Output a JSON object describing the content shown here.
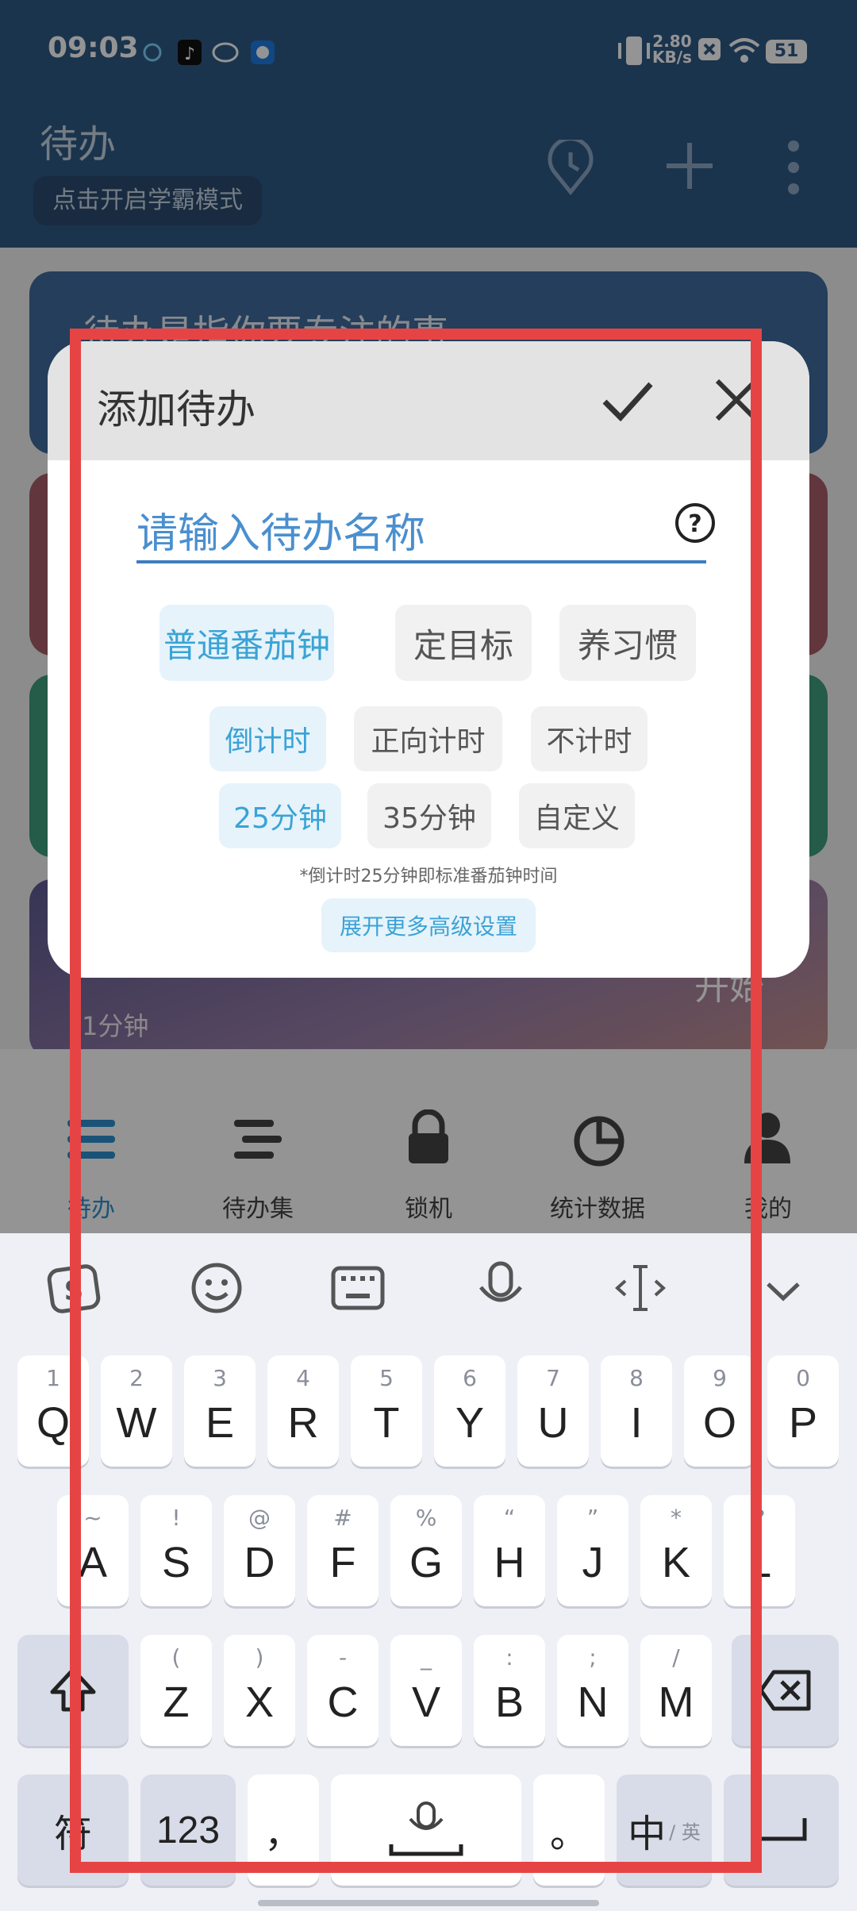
{
  "status_bar": {
    "time": "09:03",
    "net_speed_value": "2.80",
    "net_speed_unit": "KB/s",
    "battery": "51"
  },
  "header": {
    "title": "待办",
    "study_mode_button": "点击开启学霸模式"
  },
  "background": {
    "card1_text": "待办是指你要专注的事",
    "card_start_label": "开始",
    "card_duration": "1分钟"
  },
  "bottom_nav": {
    "items": [
      {
        "label": "待办"
      },
      {
        "label": "待办集"
      },
      {
        "label": "锁机"
      },
      {
        "label": "统计数据"
      },
      {
        "label": "我的"
      }
    ]
  },
  "dialog": {
    "title": "添加待办",
    "name_placeholder": "请输入待办名称",
    "mode_options": [
      "普通番茄钟",
      "定目标",
      "养习惯"
    ],
    "timer_options": [
      "倒计时",
      "正向计时",
      "不计时"
    ],
    "duration_options": [
      "25分钟",
      "35分钟",
      "自定义"
    ],
    "hint": "*倒计时25分钟即标准番茄钟时间",
    "advanced_button": "展开更多高级设置"
  },
  "keyboard": {
    "row1": [
      {
        "sub": "1",
        "main": "Q"
      },
      {
        "sub": "2",
        "main": "W"
      },
      {
        "sub": "3",
        "main": "E"
      },
      {
        "sub": "4",
        "main": "R"
      },
      {
        "sub": "5",
        "main": "T"
      },
      {
        "sub": "6",
        "main": "Y"
      },
      {
        "sub": "7",
        "main": "U"
      },
      {
        "sub": "8",
        "main": "I"
      },
      {
        "sub": "9",
        "main": "O"
      },
      {
        "sub": "0",
        "main": "P"
      }
    ],
    "row2": [
      {
        "sub": "~",
        "main": "A"
      },
      {
        "sub": "!",
        "main": "S"
      },
      {
        "sub": "@",
        "main": "D"
      },
      {
        "sub": "#",
        "main": "F"
      },
      {
        "sub": "%",
        "main": "G"
      },
      {
        "sub": "“",
        "main": "H"
      },
      {
        "sub": "”",
        "main": "J"
      },
      {
        "sub": "*",
        "main": "K"
      },
      {
        "sub": "?",
        "main": "L"
      }
    ],
    "row3": [
      {
        "sub": "(",
        "main": "Z"
      },
      {
        "sub": ")",
        "main": "X"
      },
      {
        "sub": "-",
        "main": "C"
      },
      {
        "sub": "_",
        "main": "V"
      },
      {
        "sub": ":",
        "main": "B"
      },
      {
        "sub": ";",
        "main": "N"
      },
      {
        "sub": "/",
        "main": "M"
      }
    ],
    "symbol_key": "符",
    "number_key": "123",
    "comma_key": "，",
    "period_key": "。",
    "lang_key_main": "中",
    "lang_key_sub": "/ 英"
  },
  "colors": {
    "accent": "#3aa3d6",
    "header_bg": "#2f5a85",
    "highlight_frame": "#e64444"
  }
}
